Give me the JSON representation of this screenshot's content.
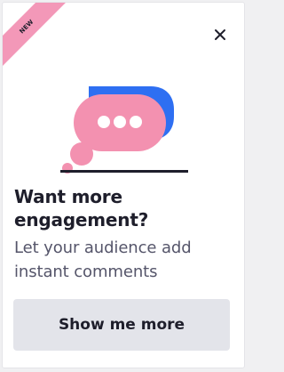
{
  "badge": {
    "label": "NEW",
    "color": "#f398b8"
  },
  "close": {
    "icon": "close-icon"
  },
  "illustration": {
    "icon": "chat-bubbles-icon",
    "colors": {
      "back_bubble": "#2e6ff2",
      "front_bubble": "#f391b0",
      "dots": "#ffffff",
      "underline": "#1e1e2b"
    }
  },
  "card": {
    "title": "Want more engagement?",
    "description": "Let your audience add instant comments",
    "cta_label": "Show me more"
  }
}
